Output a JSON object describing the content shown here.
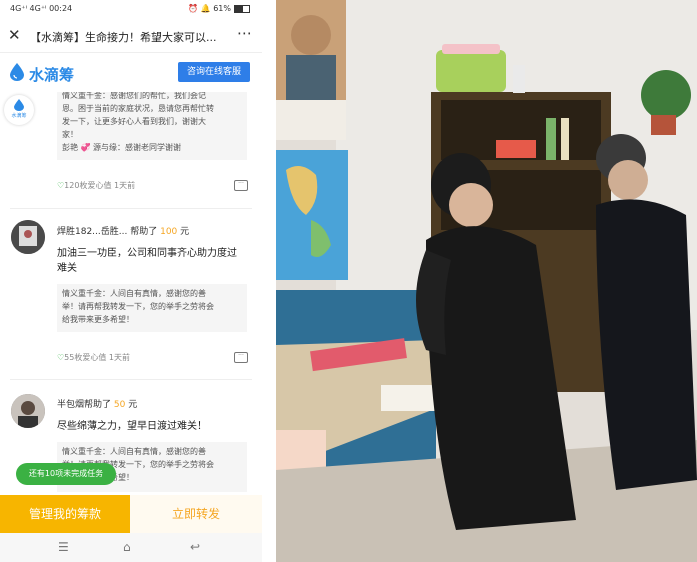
{
  "status": {
    "signal": "4G⁺ᴵ 4G⁺ᴵ",
    "time": "00:24",
    "right": "⏰ 🔔 61%"
  },
  "titlebar": {
    "close_icon": "close-icon",
    "title": "【水滴筹】生命接力！希望大家可以...",
    "more_icon": "more-icon"
  },
  "brand": {
    "name": "水滴筹",
    "service_button": "咨询在线客服",
    "side_badge": "水滴筹"
  },
  "feed": [
    {
      "quote_lines": [
        "情义重千金：感谢您们的帮忙，我们会记",
        "恩。困于当前的家庭状况，恳请您再帮忙转",
        "发一下，让更多好心人看到我们，谢谢大",
        "家！",
        "彭艳 💞 源与缘：感谢老同学谢谢"
      ],
      "love": "120枚爱心值",
      "time": "1天前"
    },
    {
      "name": "焊胜182...岳胜...",
      "helped": "帮助了",
      "amount": "100",
      "unit": "元",
      "message_lines": [
        "加油三一功臣，公司和同事齐心助力度过",
        "难关"
      ],
      "quote_lines": [
        "情义重千金：人间自有真情，感谢您的善",
        "举！请再帮我转发一下，您的举手之劳将会",
        "给我带来更多希望！"
      ],
      "love": "55枚爱心值",
      "time": "1天前"
    },
    {
      "name": "半包烟帮助了",
      "amount": "50",
      "unit": "元",
      "message_lines": [
        "尽些绵薄之力，望早日渡过难关！"
      ],
      "quote_lines": [
        "情义重千金：人间自有真情，感谢您的善",
        "举！请再帮我转发一下，您的举手之劳将会",
        "给我带来更多希望！"
      ]
    }
  ],
  "toast": "还有10项未完成任务",
  "bottom": {
    "manage": "管理我的筹款",
    "share": "立即转发"
  },
  "navbar": {
    "menu": "☰",
    "home": "⌂",
    "back": "↩"
  }
}
